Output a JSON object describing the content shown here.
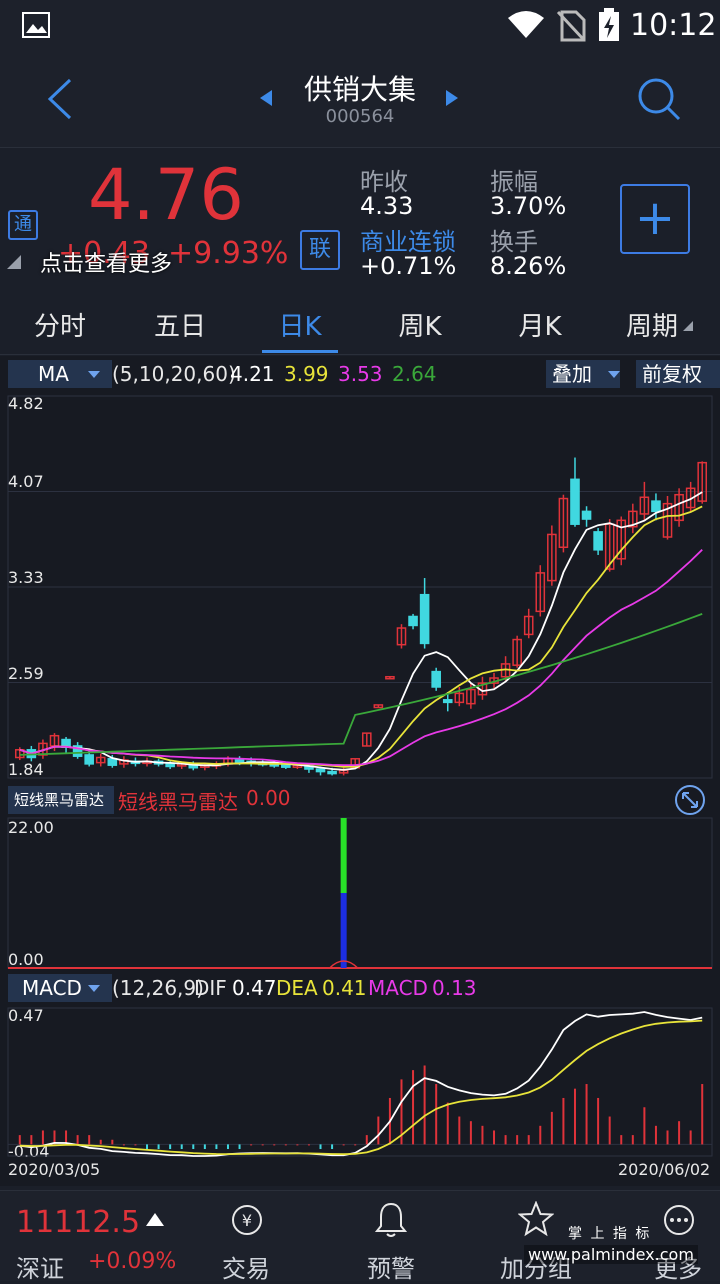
{
  "status": {
    "time": "10:12"
  },
  "header": {
    "title": "供销大集",
    "code": "000564"
  },
  "quote": {
    "price": "4.76",
    "change": "+0.43",
    "change_pct": "+9.93%",
    "tong_badge": "通",
    "lian_badge": "联",
    "tap_more": "点击查看更多",
    "prev_close_label": "昨收",
    "prev_close": "4.33",
    "amplitude_label": "振幅",
    "amplitude": "3.70%",
    "sector_label": "商业连锁",
    "sector_change": "+0.71%",
    "turnover_label": "换手",
    "turnover": "8.26%",
    "add_label": "+"
  },
  "tabs": [
    "分时",
    "五日",
    "日K",
    "周K",
    "月K",
    "周期"
  ],
  "ma": {
    "selector": "MA",
    "params": "(5,10,20,60)",
    "v1": "4.21",
    "v2": "3.99",
    "v3": "3.53",
    "v4": "2.64",
    "overlay": "叠加",
    "adjust": "前复权",
    "y_labels": [
      "4.82",
      "4.07",
      "3.33",
      "2.59",
      "1.84"
    ]
  },
  "radar": {
    "selector": "短线黑马雷达",
    "name": "短线黑马雷达",
    "value": "0.00",
    "y_top": "22.00",
    "y_bottom": "0.00"
  },
  "macd": {
    "selector": "MACD",
    "params": "(12,26,9)",
    "dif_label": "DIF",
    "dif": "0.47",
    "dea_label": "DEA",
    "dea": "0.41",
    "macd_label": "MACD",
    "macd": "0.13",
    "y_top": "0.47",
    "y_bottom": "-0.04",
    "date_start": "2020/03/05",
    "date_end": "2020/06/02"
  },
  "bottom": {
    "index_value": "11112.5",
    "index_name": "深证",
    "index_change": "+0.09%",
    "nav": [
      "交易",
      "预警",
      "加分组",
      "更多"
    ],
    "watermark_top": "掌 上 指 标",
    "watermark_url": "www.palmindex.com"
  },
  "colors": {
    "up": "#e0333a",
    "down": "#40d8e0",
    "accent": "#3d8ae8",
    "ma5": "#ffffff",
    "ma10": "#e8e43a",
    "ma20": "#e83ae8",
    "ma60": "#3aa83a"
  },
  "chart_data": {
    "type": "candlestick",
    "ylim": [
      1.84,
      4.82
    ],
    "candles": [
      [
        2.0,
        2.06,
        1.98,
        2.08
      ],
      [
        2.06,
        2.0,
        1.97,
        2.09
      ],
      [
        2.02,
        2.11,
        1.99,
        2.14
      ],
      [
        2.09,
        2.17,
        2.05,
        2.19
      ],
      [
        2.14,
        2.08,
        2.03,
        2.16
      ],
      [
        2.09,
        2.01,
        1.99,
        2.12
      ],
      [
        2.02,
        1.95,
        1.93,
        2.06
      ],
      [
        1.96,
        2.0,
        1.93,
        2.03
      ],
      [
        1.99,
        1.94,
        1.92,
        2.02
      ],
      [
        1.95,
        1.98,
        1.92,
        2.01
      ],
      [
        1.97,
        1.96,
        1.93,
        2.0
      ],
      [
        1.96,
        1.97,
        1.93,
        2.0
      ],
      [
        1.97,
        1.95,
        1.93,
        1.99
      ],
      [
        1.95,
        1.93,
        1.91,
        1.97
      ],
      [
        1.94,
        1.95,
        1.91,
        1.97
      ],
      [
        1.94,
        1.92,
        1.9,
        1.97
      ],
      [
        1.93,
        1.94,
        1.9,
        1.96
      ],
      [
        1.94,
        1.95,
        1.91,
        1.97
      ],
      [
        1.95,
        1.99,
        1.93,
        2.01
      ],
      [
        1.98,
        1.97,
        1.94,
        2.01
      ],
      [
        1.97,
        1.96,
        1.93,
        2.0
      ],
      [
        1.96,
        1.95,
        1.93,
        1.98
      ],
      [
        1.95,
        1.94,
        1.92,
        1.97
      ],
      [
        1.94,
        1.93,
        1.91,
        1.96
      ],
      [
        1.93,
        1.94,
        1.91,
        1.96
      ],
      [
        1.93,
        1.91,
        1.88,
        1.95
      ],
      [
        1.91,
        1.89,
        1.86,
        1.93
      ],
      [
        1.89,
        1.88,
        1.86,
        1.92
      ],
      [
        1.88,
        1.9,
        1.86,
        1.92
      ],
      [
        1.92,
        1.99,
        1.92,
        1.99
      ],
      [
        2.09,
        2.19,
        2.09,
        2.19
      ],
      [
        2.39,
        2.41,
        2.39,
        2.41
      ],
      [
        2.62,
        2.63,
        2.62,
        2.63
      ],
      [
        2.88,
        3.01,
        2.85,
        3.04
      ],
      [
        3.1,
        3.03,
        3.0,
        3.12
      ],
      [
        3.27,
        2.89,
        2.85,
        3.4
      ],
      [
        2.67,
        2.55,
        2.52,
        2.7
      ],
      [
        2.45,
        2.43,
        2.36,
        2.51
      ],
      [
        2.43,
        2.5,
        2.4,
        2.55
      ],
      [
        2.42,
        2.53,
        2.38,
        2.58
      ],
      [
        2.49,
        2.58,
        2.45,
        2.63
      ],
      [
        2.58,
        2.62,
        2.54,
        2.66
      ],
      [
        2.63,
        2.73,
        2.6,
        2.79
      ],
      [
        2.72,
        2.92,
        2.7,
        2.95
      ],
      [
        2.96,
        3.1,
        2.93,
        3.16
      ],
      [
        3.14,
        3.44,
        3.1,
        3.5
      ],
      [
        3.38,
        3.74,
        3.34,
        3.81
      ],
      [
        3.64,
        4.02,
        3.6,
        4.05
      ],
      [
        4.17,
        3.82,
        3.8,
        4.34
      ],
      [
        3.92,
        3.86,
        3.8,
        3.96
      ],
      [
        3.76,
        3.62,
        3.58,
        3.79
      ],
      [
        3.47,
        3.82,
        3.45,
        3.86
      ],
      [
        3.55,
        3.85,
        3.5,
        3.88
      ],
      [
        3.8,
        3.92,
        3.75,
        3.98
      ],
      [
        3.9,
        4.03,
        3.85,
        4.15
      ],
      [
        4.0,
        3.92,
        3.85,
        4.06
      ],
      [
        3.72,
        3.98,
        3.7,
        4.04
      ],
      [
        3.85,
        4.05,
        3.8,
        4.1
      ],
      [
        3.95,
        4.1,
        3.92,
        4.15
      ],
      [
        4.0,
        4.3,
        3.98,
        4.31
      ]
    ],
    "macd_bars": [
      0.02,
      0.02,
      0.03,
      0.03,
      0.03,
      0.02,
      0.02,
      0.01,
      0.01,
      0.0,
      0.0,
      -0.01,
      -0.01,
      -0.01,
      -0.01,
      -0.01,
      -0.01,
      -0.01,
      -0.01,
      -0.01,
      0.0,
      0.0,
      0.0,
      0.0,
      0.0,
      0.0,
      -0.01,
      -0.01,
      0.0,
      0.0,
      0.02,
      0.06,
      0.1,
      0.14,
      0.16,
      0.17,
      0.13,
      0.09,
      0.06,
      0.05,
      0.04,
      0.03,
      0.02,
      0.02,
      0.02,
      0.04,
      0.07,
      0.1,
      0.12,
      0.13,
      0.1,
      0.06,
      0.02,
      0.02,
      0.08,
      0.04,
      0.03,
      0.05,
      0.03,
      0.13
    ],
    "radar_spike_index": 28
  }
}
